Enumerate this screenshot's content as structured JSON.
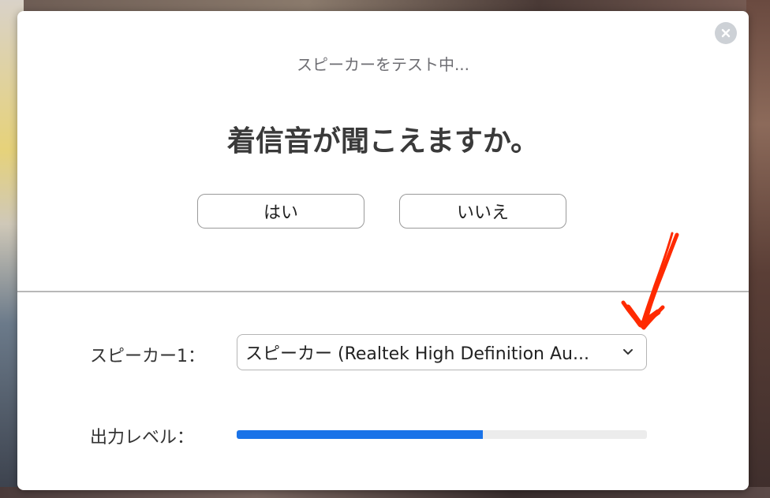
{
  "dialog": {
    "subtitle": "スピーカーをテスト中...",
    "headline": "着信音が聞こえますか。",
    "yes_label": "はい",
    "no_label": "いいえ"
  },
  "speaker": {
    "label": "スピーカー1：",
    "selected": "スピーカー (Realtek High Definition Au..."
  },
  "output_level": {
    "label": "出力レベル：",
    "fraction": 0.6
  },
  "icons": {
    "close": "close-icon",
    "dropdown": "chevron-down-icon"
  },
  "colors": {
    "accent": "#1a73e8",
    "annotation": "#ff2a00"
  }
}
